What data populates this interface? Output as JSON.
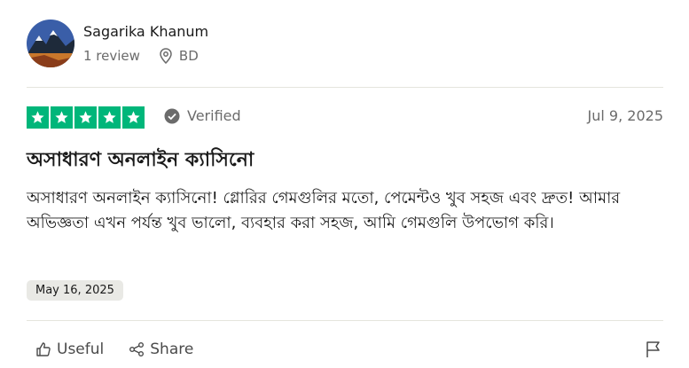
{
  "reviewer": {
    "name": "Sagarika Khanum",
    "reviews": "1 review",
    "country": "BD"
  },
  "review": {
    "stars": 5,
    "verified_label": "Verified",
    "date": "Jul 9, 2025",
    "title": "অসাধারণ অনলাইন ক্যাসিনো",
    "body": "অসাধারণ অনলাইন ক্যাসিনো! গ্লোরির গেমগুলির মতো, পেমেন্টও খুব সহজ এবং দ্রুত! আমার অভিজ্ঞতা এখন পর্যন্ত খুব ভালো, ব্যবহার করা সহজ, আমি গেমগুলি উপভোগ করি।",
    "experience_date": "May 16, 2025"
  },
  "actions": {
    "useful_label": "Useful",
    "share_label": "Share"
  },
  "colors": {
    "star_green": "#00b67a",
    "muted_text": "#6b6b6b"
  },
  "icons": [
    "location-pin-icon",
    "verified-check-icon",
    "thumbs-up-icon",
    "share-icon",
    "flag-icon",
    "star-icon"
  ]
}
